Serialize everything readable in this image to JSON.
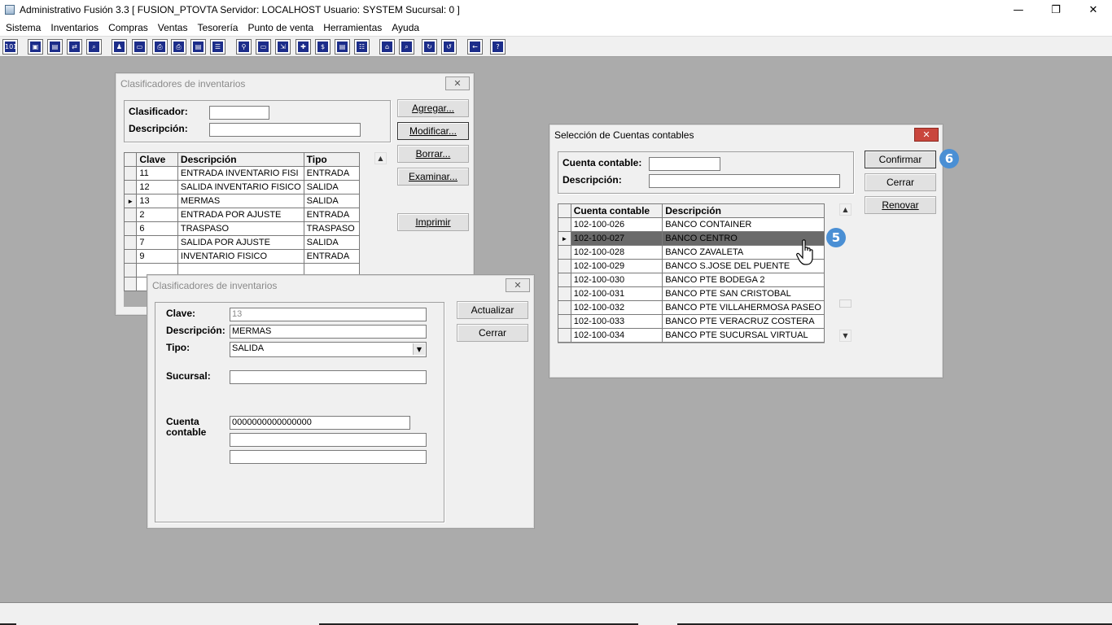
{
  "app": {
    "title": "Administrativo Fusión 3.3 [ FUSION_PTOVTA   Servidor: LOCALHOST   Usuario: SYSTEM    Sucursal: 0 ]",
    "minimize": "—",
    "restore": "❐",
    "close": "✕"
  },
  "menu": [
    "Sistema",
    "Inventarios",
    "Compras",
    "Ventas",
    "Tesorería",
    "Punto de venta",
    "Herramientas",
    "Ayuda"
  ],
  "toolbar_icons": [
    "calculator-icon",
    "copy-icon",
    "clipboard-icon",
    "transfer-icon",
    "search-doc-icon",
    "user-icon",
    "folder-icon",
    "print-icon",
    "printer-icon",
    "document-icon",
    "list-icon",
    "binoculars-icon",
    "box-icon",
    "export-icon",
    "add-icon",
    "dollar-icon",
    "report-icon",
    "table-icon",
    "home-icon",
    "zoom-icon",
    "refresh-icon",
    "undo-icon",
    "back-arrow-icon",
    "help-icon"
  ],
  "toolbar_glyphs": [
    "101",
    "▣",
    "▤",
    "⇄",
    "⌕",
    "♟",
    "▭",
    "⎙",
    "⎙",
    "▤",
    "☰",
    "⚲",
    "▭",
    "⇲",
    "✚",
    "$",
    "▤",
    "☷",
    "⌂",
    "⌕",
    "↻",
    "↺",
    "←",
    "?"
  ],
  "clasificadores_bg": {
    "title": "Clasificadores de inventarios",
    "clasificador_label": "Clasificador:",
    "descripcion_label": "Descripción:",
    "clasificador_value": "",
    "descripcion_value": "",
    "buttons": {
      "agregar": "Agregar...",
      "modificar": "Modificar...",
      "borrar": "Borrar...",
      "examinar": "Examinar...",
      "imprimir": "Imprimir"
    },
    "columns": [
      "Clave",
      "Descripción",
      "Tipo"
    ],
    "rows": [
      {
        "clave": "11",
        "descripcion": "ENTRADA INVENTARIO FISI",
        "tipo": "ENTRADA"
      },
      {
        "clave": "12",
        "descripcion": "SALIDA INVENTARIO FISICO",
        "tipo": "SALIDA"
      },
      {
        "clave": "13",
        "descripcion": "MERMAS",
        "tipo": "SALIDA"
      },
      {
        "clave": "2",
        "descripcion": "ENTRADA POR AJUSTE",
        "tipo": "ENTRADA"
      },
      {
        "clave": "6",
        "descripcion": "TRASPASO",
        "tipo": "TRASPASO"
      },
      {
        "clave": "7",
        "descripcion": "SALIDA POR AJUSTE",
        "tipo": "SALIDA"
      },
      {
        "clave": "9",
        "descripcion": "INVENTARIO FISICO",
        "tipo": "ENTRADA"
      }
    ],
    "selected_marker": "►"
  },
  "clasificador_edit": {
    "title": "Clasificadores de inventarios",
    "clave_label": "Clave:",
    "clave_value": "13",
    "descripcion_label": "Descripción:",
    "descripcion_value": "MERMAS",
    "tipo_label": "Tipo:",
    "tipo_value": "SALIDA",
    "sucursal_label": "Sucursal:",
    "sucursal_value": "",
    "cuenta_label_1": "Cuenta",
    "cuenta_label_2": "contable",
    "cuenta_value": "0000000000000000",
    "cuenta_extra_1": "",
    "cuenta_extra_2": "",
    "actualizar": "Actualizar",
    "cerrar": "Cerrar"
  },
  "seleccion_cuentas": {
    "title": "Selección de Cuentas contables",
    "cuenta_label": "Cuenta contable:",
    "descripcion_label": "Descripción:",
    "cuenta_value": "",
    "descripcion_value": "",
    "buttons": {
      "confirmar": "Confirmar",
      "cerrar": "Cerrar",
      "renovar": "Renovar"
    },
    "columns": [
      "Cuenta contable",
      "Descripción"
    ],
    "rows": [
      {
        "cuenta": "102-100-026",
        "descripcion": "BANCO CONTAINER"
      },
      {
        "cuenta": "102-100-027",
        "descripcion": "BANCO CENTRO"
      },
      {
        "cuenta": "102-100-028",
        "descripcion": "BANCO ZAVALETA"
      },
      {
        "cuenta": "102-100-029",
        "descripcion": "BANCO S.JOSE DEL PUENTE"
      },
      {
        "cuenta": "102-100-030",
        "descripcion": "BANCO PTE BODEGA 2"
      },
      {
        "cuenta": "102-100-031",
        "descripcion": "BANCO PTE SAN CRISTOBAL"
      },
      {
        "cuenta": "102-100-032",
        "descripcion": "BANCO PTE VILLAHERMOSA PASEO"
      },
      {
        "cuenta": "102-100-033",
        "descripcion": "BANCO PTE VERACRUZ COSTERA"
      },
      {
        "cuenta": "102-100-034",
        "descripcion": "BANCO PTE SUCURSAL VIRTUAL"
      }
    ],
    "selected_marker": "►"
  },
  "badges": {
    "five": "5",
    "six": "6"
  },
  "colors": {
    "workspace": "#ababab",
    "badge": "#4a8fd4",
    "close_active": "#c9463d",
    "selected_row": "#6a6a6a"
  }
}
